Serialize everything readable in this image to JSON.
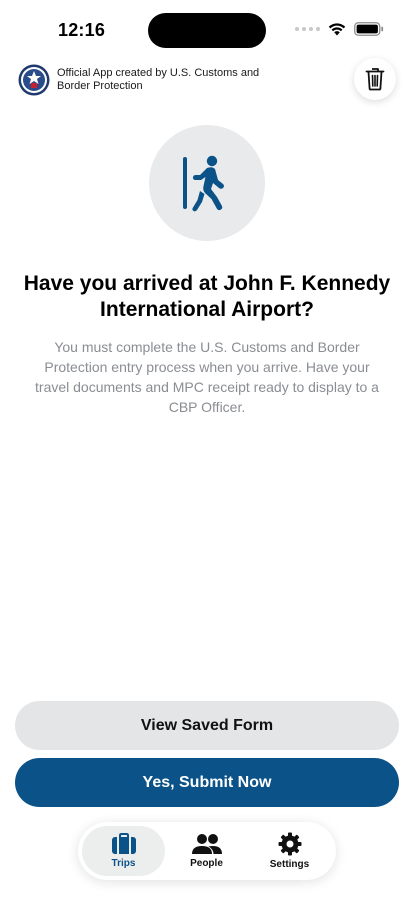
{
  "status_bar": {
    "time": "12:16"
  },
  "header": {
    "official_text": "Official App created by U.S. Customs and Border Protection",
    "seal_icon": "cbp-seal-icon",
    "delete_icon": "trash-icon"
  },
  "hero": {
    "icon": "walk-through-door-icon",
    "title": "Have you arrived at John F. Kennedy International Airport?",
    "description": "You must complete the U.S. Customs and Border Protection entry process when you arrive. Have your travel documents and MPC receipt ready to display to a CBP Officer."
  },
  "actions": {
    "secondary_label": "View Saved Form",
    "primary_label": "Yes, Submit Now"
  },
  "tabs": [
    {
      "label": "Trips",
      "icon": "suitcase-icon",
      "active": true
    },
    {
      "label": "People",
      "icon": "people-icon",
      "active": false
    },
    {
      "label": "Settings",
      "icon": "gear-icon",
      "active": false
    }
  ],
  "colors": {
    "brand_blue": "#0b5289",
    "secondary_button": "#e4e5e7",
    "hero_circle": "#e9eaec",
    "description_text": "#8a8d92"
  }
}
